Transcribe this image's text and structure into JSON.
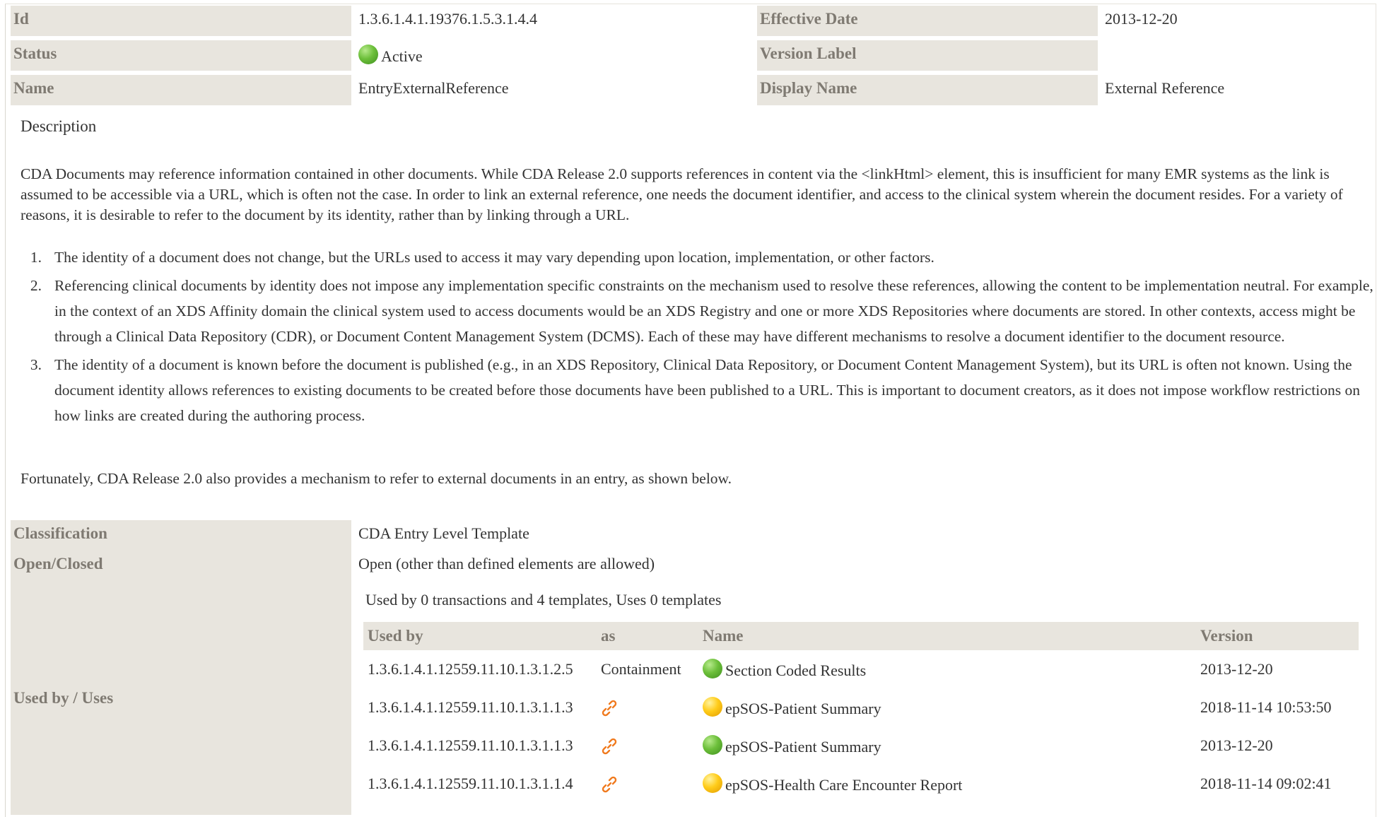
{
  "header": {
    "id_label": "Id",
    "id_value": "1.3.6.1.4.1.19376.1.5.3.1.4.4",
    "effective_date_label": "Effective Date",
    "effective_date_value": "2013-12-20",
    "status_label": "Status",
    "status_value": "Active",
    "status_color": "#6cbf3a",
    "version_label_label": "Version Label",
    "version_label_value": "",
    "name_label": "Name",
    "name_value": "EntryExternalReference",
    "display_name_label": "Display Name",
    "display_name_value": "External Reference"
  },
  "description": {
    "heading": "Description",
    "intro": "CDA Documents may reference information contained in other documents. While CDA Release 2.0 supports references in content via the <linkHtml> element, this is insufficient for many EMR systems as the link is assumed to be accessible via a URL, which is often not the case. In order to link an external reference, one needs the document identifier, and access to the clinical system wherein the document resides. For a variety of reasons, it is desirable to refer to the document by its identity, rather than by linking through a URL.",
    "items": [
      {
        "num": "1.",
        "text": "The identity of a document does not change, but the URLs used to access it may vary depending upon location, implementation, or other factors."
      },
      {
        "num": "2.",
        "text": "Referencing clinical documents by identity does not impose any implementation specific constraints on the mechanism used to resolve these references, allowing the content to be implementation neutral. For example, in the context of an XDS Affinity domain the clinical system used to access documents would be an XDS Registry and one or more XDS Repositories where documents are stored. In other contexts, access might be through a Clinical Data Repository (CDR), or Document Content Management System (DCMS). Each of these may have different mechanisms to resolve a document identifier to the document resource."
      },
      {
        "num": "3.",
        "text": "The identity of a document is known before the document is published (e.g., in an XDS Repository, Clinical Data Repository, or Document Content Management System), but its URL is often not known. Using the document identity allows references to existing documents to be created before those documents have been published to a URL. This is important to document creators, as it does not impose workflow restrictions on how links are created during the authoring process."
      }
    ],
    "outro": "Fortunately, CDA Release 2.0 also provides a mechanism to refer to external documents in an entry, as shown below."
  },
  "classification": {
    "label": "Classification",
    "value": "CDA Entry Level Template"
  },
  "open_closed": {
    "label": "Open/Closed",
    "value": "Open (other than defined elements are allowed)"
  },
  "used_by": {
    "label": "Used by / Uses",
    "summary": "Used by 0 transactions and 4 templates, Uses 0 templates",
    "columns": {
      "used_by": "Used by",
      "as": "as",
      "name": "Name",
      "version": "Version"
    },
    "rows": [
      {
        "id": "1.3.6.1.4.1.12559.11.10.1.3.1.2.5",
        "as": "Containment",
        "as_icon": "",
        "status": "green",
        "name": "Section Coded Results",
        "version": "2013-12-20"
      },
      {
        "id": "1.3.6.1.4.1.12559.11.10.1.3.1.1.3",
        "as": "",
        "as_icon": "link-icon",
        "status": "yellow",
        "name": "epSOS-Patient Summary",
        "version": "2018-11-14 10:53:50"
      },
      {
        "id": "1.3.6.1.4.1.12559.11.10.1.3.1.1.3",
        "as": "",
        "as_icon": "link-icon",
        "status": "green",
        "name": "epSOS-Patient Summary",
        "version": "2013-12-20"
      },
      {
        "id": "1.3.6.1.4.1.12559.11.10.1.3.1.1.4",
        "as": "",
        "as_icon": "link-icon",
        "status": "yellow",
        "name": "epSOS-Health Care Encounter Report",
        "version": "2018-11-14 09:02:41"
      }
    ]
  },
  "colors": {
    "label_bg": "#e8e5de",
    "label_text": "#7f7a72",
    "active_green": "#6cbf3a",
    "draft_yellow": "#ffcc1a",
    "link_orange": "#f07a1e"
  }
}
